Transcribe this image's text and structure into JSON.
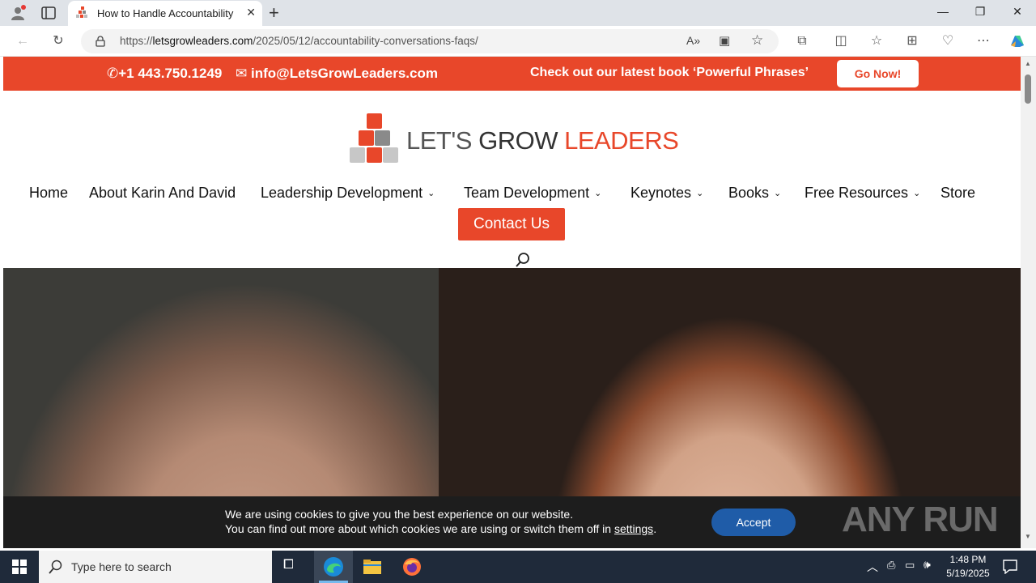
{
  "browser": {
    "tab_title": "How to Handle Accountability Conversations FAQs",
    "url_domain": "letsgrowleaders.com",
    "url_prefix": "https://",
    "url_path": "/2025/05/12/accountability-conversations-faqs/"
  },
  "topbar": {
    "phone": "+1 443.750.1249",
    "email": "info@LetsGrowLeaders.com",
    "promo": "Check out our latest book ‘Powerful Phrases’",
    "cta": "Go Now!"
  },
  "logo": {
    "part1": "LET'S",
    "part2": "GROW",
    "part3": "LEADERS"
  },
  "nav": {
    "items": [
      {
        "label": "Home"
      },
      {
        "label": "About Karin And David"
      },
      {
        "label": "Leadership Development"
      },
      {
        "label": "Team Development"
      },
      {
        "label": "Keynotes"
      },
      {
        "label": "Books"
      },
      {
        "label": "Free Resources"
      },
      {
        "label": "Store"
      }
    ],
    "contact": "Contact Us"
  },
  "cookie": {
    "line1": "We are using cookies to give you the best experience on our website.",
    "line2_pre": "You can find out more about which cookies we are using or switch them off in",
    "line2_link": "settings",
    "line2_post": ".",
    "accept": "Accept"
  },
  "watermark": "ANY RUN",
  "taskbar": {
    "search_placeholder": "Type here to search",
    "time": "1:48 PM",
    "date": "5/19/2025"
  },
  "colors": {
    "brand": "#e8472a",
    "accept": "#1f5ca8"
  }
}
